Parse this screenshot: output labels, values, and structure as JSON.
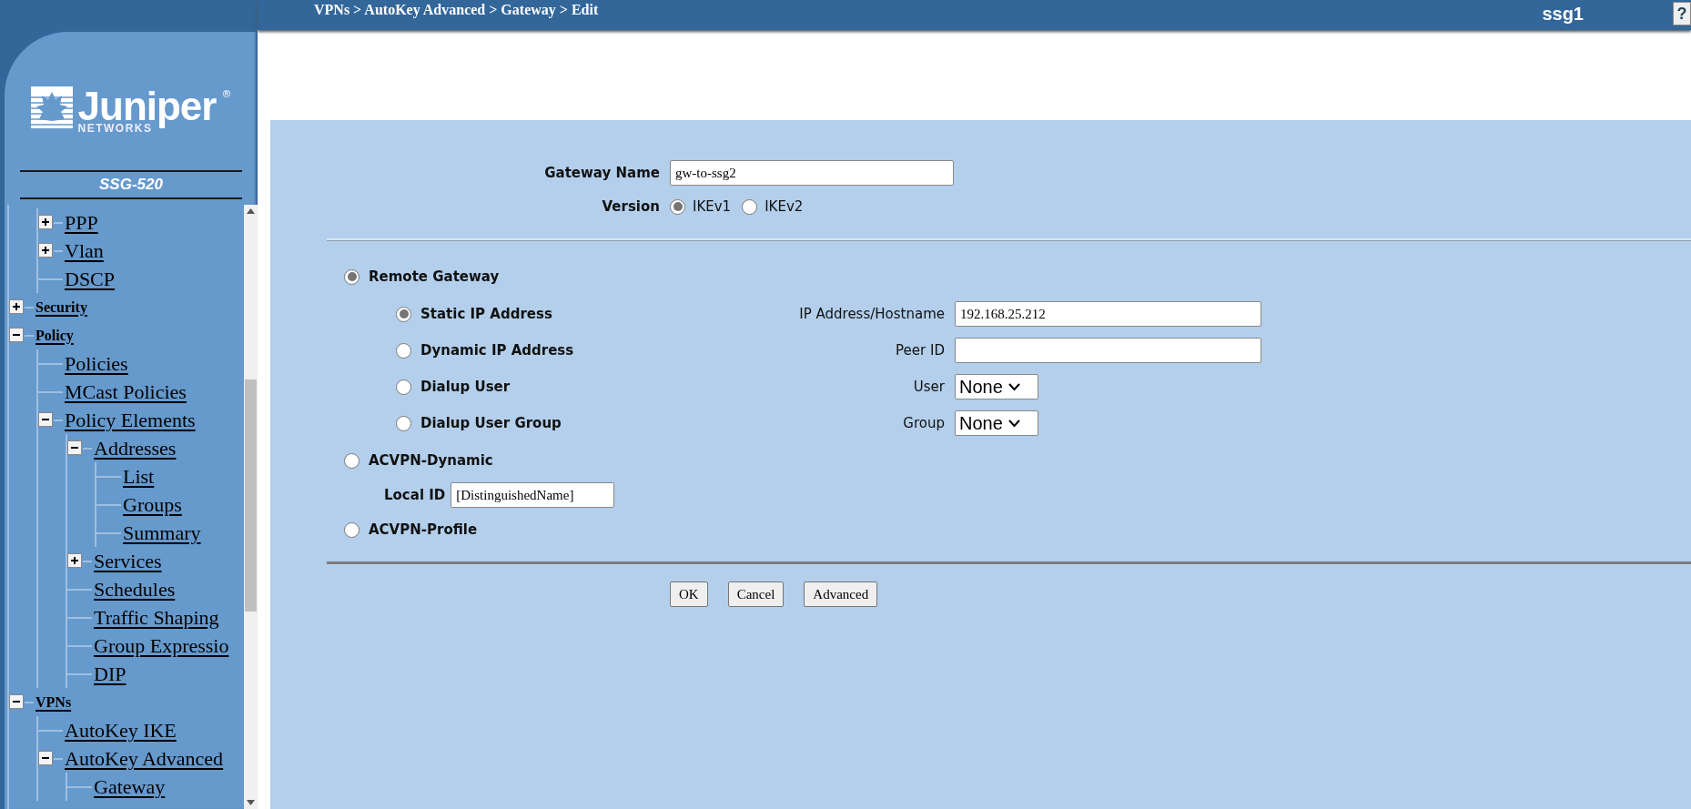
{
  "header": {
    "breadcrumb": "VPNs > AutoKey Advanced > Gateway > Edit",
    "device_name": "ssg1",
    "help_button": "?"
  },
  "sidebar": {
    "logo": {
      "wordmark": "Juniper",
      "registered": "®",
      "tagline": "NETWORKS"
    },
    "model": "SSG-520",
    "tree": [
      {
        "children": [
          {
            "label": "PPP",
            "expanded": false
          },
          {
            "label": "Vlan",
            "expanded": false
          },
          {
            "label": "DSCP"
          }
        ]
      },
      {
        "label": "Security",
        "expanded": false
      },
      {
        "label": "Policy",
        "expanded": true,
        "children": [
          {
            "label": "Policies"
          },
          {
            "label": "MCast Policies"
          },
          {
            "label": "Policy Elements",
            "expanded": true,
            "children": [
              {
                "label": "Addresses",
                "expanded": true,
                "children": [
                  {
                    "label": "List"
                  },
                  {
                    "label": "Groups"
                  },
                  {
                    "label": "Summary"
                  }
                ]
              },
              {
                "label": "Services",
                "expanded": false
              },
              {
                "label": "Schedules"
              },
              {
                "label": "Traffic Shaping"
              },
              {
                "label": "Group Expressio"
              },
              {
                "label": "DIP"
              }
            ]
          }
        ]
      },
      {
        "label": "VPNs",
        "expanded": true,
        "children": [
          {
            "label": "AutoKey IKE"
          },
          {
            "label": "AutoKey Advanced",
            "expanded": true,
            "children": [
              {
                "label": "Gateway"
              }
            ]
          }
        ]
      }
    ]
  },
  "form": {
    "gateway_name": {
      "label": "Gateway Name",
      "value": "gw-to-ssg2"
    },
    "version": {
      "label": "Version",
      "options": [
        {
          "label": "IKEv1",
          "selected": true
        },
        {
          "label": "IKEv2",
          "selected": false
        }
      ]
    },
    "gateway_types": [
      {
        "kind": "remote",
        "label": "Remote Gateway",
        "selected": true,
        "address_types": [
          {
            "label": "Static IP Address",
            "selected": true
          },
          {
            "label": "Dynamic IP Address",
            "selected": false
          },
          {
            "label": "Dialup User",
            "selected": false
          },
          {
            "label": "Dialup User Group",
            "selected": false
          }
        ],
        "fields": [
          {
            "kind": "text",
            "label": "IP Address/Hostname",
            "value": "192.168.25.212"
          },
          {
            "kind": "text",
            "label": "Peer ID"
          },
          {
            "kind": "select",
            "label": "User",
            "value": "None"
          },
          {
            "kind": "select",
            "label": "Group",
            "value": "None"
          }
        ]
      },
      {
        "kind": "dynamic",
        "label": "ACVPN-Dynamic",
        "selected": false,
        "local_id": {
          "label": "Local ID",
          "value": "[DistinguishedName]"
        }
      },
      {
        "kind": "profile",
        "label": "ACVPN-Profile",
        "selected": false
      }
    ],
    "buttons": [
      "OK",
      "Cancel",
      "Advanced"
    ]
  }
}
